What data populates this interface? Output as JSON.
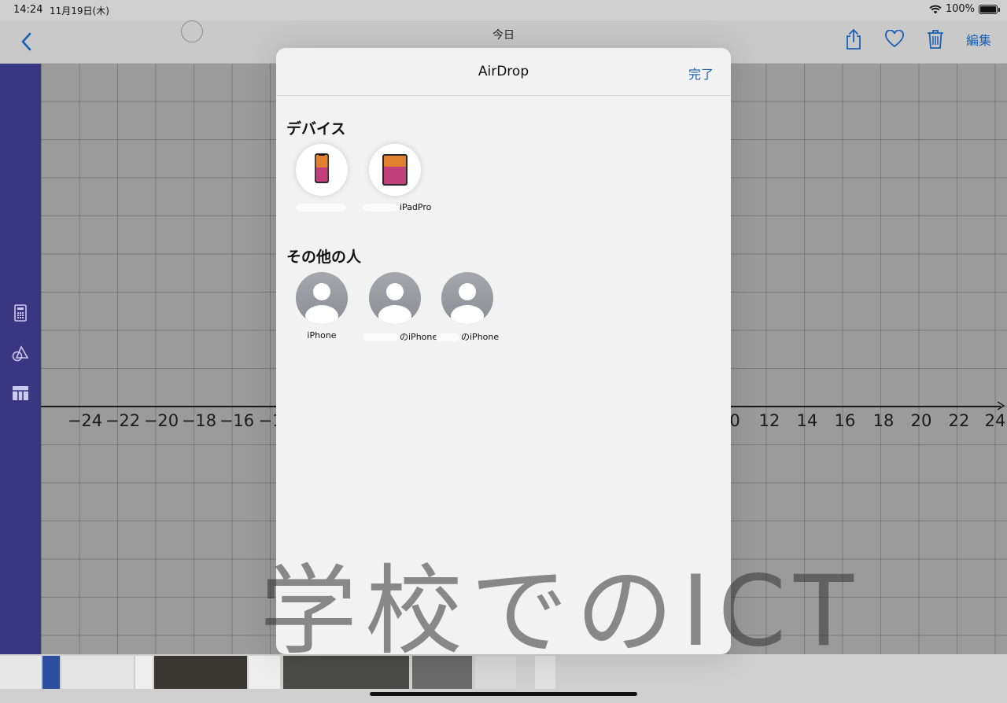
{
  "status_bar": {
    "time": "14:24",
    "date": "11月19日(木)",
    "battery": "100%"
  },
  "nav": {
    "title": "今日",
    "edit_label": "編集"
  },
  "axis": {
    "ticks": [
      "−24",
      "−22",
      "−20",
      "−18",
      "−16",
      "−1",
      "0",
      "12",
      "14",
      "16",
      "18",
      "20",
      "22",
      "24"
    ]
  },
  "sheet": {
    "title": "AirDrop",
    "done_label": "完了",
    "devices_title": "デバイス",
    "people_title": "その他の人",
    "devices": [
      {
        "label": "",
        "icon": "iphone-device-icon"
      },
      {
        "label": "iPadPro",
        "icon": "ipad-device-icon"
      }
    ],
    "people": [
      {
        "label": "iPhone"
      },
      {
        "label": "のiPhone"
      },
      {
        "label": "のiPhone"
      }
    ]
  },
  "watermark": "学校でのICT",
  "colors": {
    "accent": "#1a5fb4",
    "sidebar": "#3a3782",
    "sheet_bg": "#f2f2f2"
  }
}
